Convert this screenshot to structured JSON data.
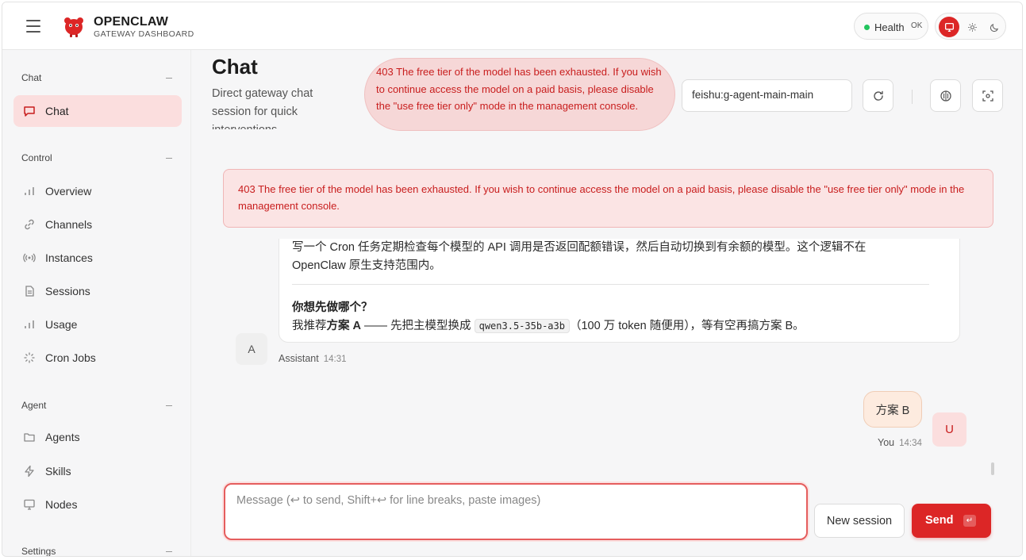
{
  "app": {
    "title": "OPENCLAW",
    "subtitle": "GATEWAY DASHBOARD",
    "brand_color": "#dc2626"
  },
  "header": {
    "health_label": "Health",
    "health_value": "OK",
    "health_color": "#22c55e",
    "theme_options": [
      "monitor-icon",
      "sun-icon",
      "moon-icon"
    ],
    "theme_selected": "monitor-icon"
  },
  "sidebar": {
    "sections": [
      {
        "title": "Chat",
        "items": [
          {
            "label": "Chat",
            "icon": "chat-icon",
            "active": true
          }
        ]
      },
      {
        "title": "Control",
        "items": [
          {
            "label": "Overview",
            "icon": "bar-chart-icon"
          },
          {
            "label": "Channels",
            "icon": "link-icon"
          },
          {
            "label": "Instances",
            "icon": "radio-icon"
          },
          {
            "label": "Sessions",
            "icon": "file-icon"
          },
          {
            "label": "Usage",
            "icon": "bar-chart-icon"
          },
          {
            "label": "Cron Jobs",
            "icon": "loader-icon"
          }
        ]
      },
      {
        "title": "Agent",
        "items": [
          {
            "label": "Agents",
            "icon": "folder-icon"
          },
          {
            "label": "Skills",
            "icon": "zap-icon"
          },
          {
            "label": "Nodes",
            "icon": "monitor-icon"
          }
        ]
      },
      {
        "title": "Settings",
        "items": []
      }
    ]
  },
  "page": {
    "title": "Chat",
    "subtitle": "Direct gateway chat session for quick interventions",
    "error_bubble": "403 The free tier of the model has been exhausted. If you wish to continue access the model on a paid basis, please disable the \"use free tier only\" mode in the management console.",
    "session_key": "feishu:g-agent-main-main",
    "error_banner": "403 The free tier of the model has been exhausted. If you wish to continue access the model on a paid basis, please disable the \"use free tier only\" mode in the management console."
  },
  "messages": {
    "assistant": {
      "paragraph": "写一个 Cron 任务定期检查每个模型的 API 调用是否返回配额错误，然后自动切换到有余额的模型。这个逻辑不在 OpenClaw 原生支持范围内。",
      "question": "你想先做哪个？",
      "rec_prefix": "我推荐",
      "rec_bold": "方案 A",
      "rec_mid": " —— 先把主模型换成 ",
      "rec_code": "qwen3.5-35b-a3b",
      "rec_suffix": "（100 万 token 随便用），等有空再搞方案 B。",
      "avatar": "A",
      "author": "Assistant",
      "time": "14:31"
    },
    "user": {
      "text": "方案 B",
      "avatar": "U",
      "author": "You",
      "time": "14:34"
    }
  },
  "composer": {
    "placeholder": "Message (↩ to send, Shift+↩ for line breaks, paste images)",
    "new_session_label": "New session",
    "send_label": "Send",
    "send_shortcut": "↵"
  }
}
